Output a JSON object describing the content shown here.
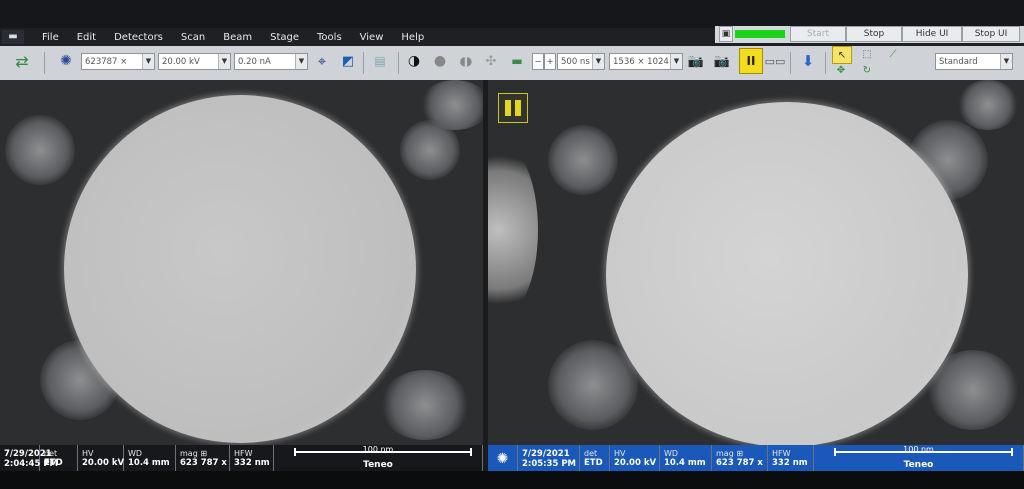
{
  "menu": [
    "File",
    "Edit",
    "Detectors",
    "Scan",
    "Beam",
    "Stage",
    "Tools",
    "View",
    "Help"
  ],
  "run_controls": {
    "start": "Start",
    "stop": "Stop",
    "hide_ui": "Hide UI",
    "stop_ui": "Stop UI",
    "progress_percent": 100
  },
  "toolbar": {
    "magnification": "623787 ×",
    "hv": "20.00 kV",
    "current": "0.20 nA",
    "minus": "−",
    "plus": "+",
    "dwell": "500 ns",
    "resolution": "1536 × 1024",
    "pause": "II",
    "preset": "Standard"
  },
  "databar_left": {
    "date": "7/29/2021",
    "time": "2:04:45 PM",
    "det_label": "det",
    "det": "ETD",
    "hv_label": "HV",
    "hv": "20.00 kV",
    "wd_label": "WD",
    "wd": "10.4 mm",
    "mag_label": "mag",
    "mag": "623 787 x",
    "hfw_label": "HFW",
    "hfw": "332 nm",
    "scale": "100 nm",
    "brand": "Teneo"
  },
  "databar_right": {
    "date": "7/29/2021",
    "time": "2:05:35 PM",
    "det_label": "det",
    "det": "ETD",
    "hv_label": "HV",
    "hv": "20.00 kV",
    "wd_label": "WD",
    "wd": "10.4 mm",
    "mag_label": "mag",
    "mag": "623 787 x",
    "hfw_label": "HFW",
    "hfw": "332 nm",
    "scale": "100 nm",
    "brand": "Teneo"
  },
  "colors": {
    "databar_active": "#1a58b9",
    "pause_yellow": "#f4dc1c",
    "progress_green": "#19d419"
  }
}
